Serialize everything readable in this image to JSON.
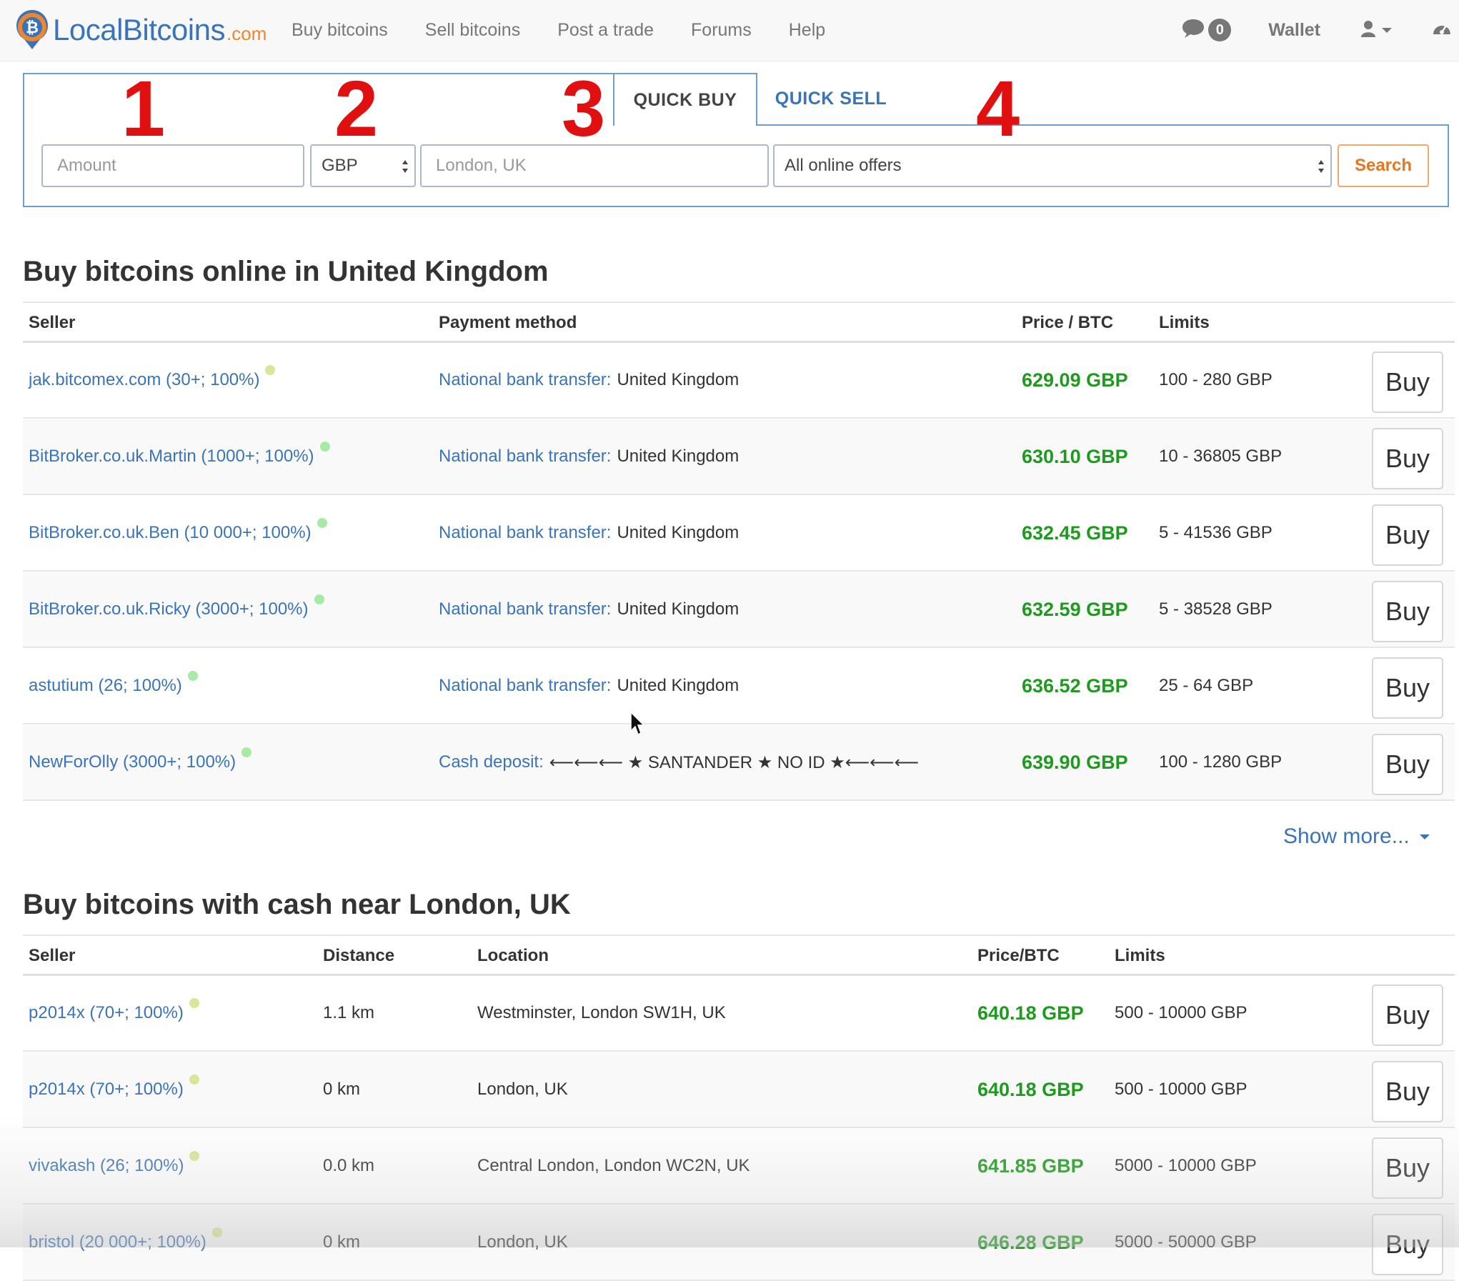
{
  "nav": {
    "logo_text": "LocalBitcoins",
    "logo_tld": ".com",
    "links": [
      "Buy bitcoins",
      "Sell bitcoins",
      "Post a trade",
      "Forums",
      "Help"
    ],
    "message_count": "0",
    "wallet": "Wallet"
  },
  "annotations": [
    "1",
    "2",
    "3",
    "4"
  ],
  "quick": {
    "tab_buy": "QUICK BUY",
    "tab_sell": "QUICK SELL",
    "amount_placeholder": "Amount",
    "currency": "GBP",
    "location_placeholder": "London, UK",
    "offer_type": "All online offers",
    "search_label": "Search"
  },
  "online": {
    "title": "Buy bitcoins online in United Kingdom",
    "headers": {
      "seller": "Seller",
      "payment": "Payment method",
      "price": "Price / BTC",
      "limits": "Limits"
    },
    "rows": [
      {
        "seller": "jak.bitcomex.com (30+; 100%)",
        "method": "National bank transfer:",
        "detail": "United Kingdom",
        "price": "629.09 GBP",
        "limits": "100 - 280 GBP",
        "buy": "Buy",
        "dot_color": "#d8e69a"
      },
      {
        "seller": "BitBroker.co.uk.Martin (1000+; 100%)",
        "method": "National bank transfer:",
        "detail": "United Kingdom",
        "price": "630.10 GBP",
        "limits": "10 - 36805 GBP",
        "buy": "Buy",
        "dot_color": "#a6eaa6"
      },
      {
        "seller": "BitBroker.co.uk.Ben (10 000+; 100%)",
        "method": "National bank transfer:",
        "detail": "United Kingdom",
        "price": "632.45 GBP",
        "limits": "5 - 41536 GBP",
        "buy": "Buy",
        "dot_color": "#a6eaa6"
      },
      {
        "seller": "BitBroker.co.uk.Ricky (3000+; 100%)",
        "method": "National bank transfer:",
        "detail": "United Kingdom",
        "price": "632.59 GBP",
        "limits": "5 - 38528 GBP",
        "buy": "Buy",
        "dot_color": "#a6eaa6"
      },
      {
        "seller": "astutium (26; 100%)",
        "method": "National bank transfer:",
        "detail": "United Kingdom",
        "price": "636.52 GBP",
        "limits": "25 - 64 GBP",
        "buy": "Buy",
        "dot_color": "#a6eaa6"
      },
      {
        "seller": "NewForOlly (3000+; 100%)",
        "method": "Cash deposit:",
        "detail": "⟵⟵⟵ ★ SANTANDER ★ NO ID ★⟵⟵⟵",
        "price": "639.90 GBP",
        "limits": "100 - 1280 GBP",
        "buy": "Buy",
        "dot_color": "#a6eaa6"
      }
    ],
    "show_more": "Show more..."
  },
  "cash": {
    "title": "Buy bitcoins with cash near London, UK",
    "headers": {
      "seller": "Seller",
      "distance": "Distance",
      "location": "Location",
      "price": "Price/BTC",
      "limits": "Limits"
    },
    "rows": [
      {
        "seller": "p2014x (70+; 100%)",
        "distance": "1.1 km",
        "location": "Westminster, London SW1H, UK",
        "price": "640.18 GBP",
        "limits": "500 - 10000 GBP",
        "buy": "Buy",
        "dot_color": "#d8e69a"
      },
      {
        "seller": "p2014x (70+; 100%)",
        "distance": "0 km",
        "location": "London, UK",
        "price": "640.18 GBP",
        "limits": "500 - 10000 GBP",
        "buy": "Buy",
        "dot_color": "#d8e69a"
      },
      {
        "seller": "vivakash (26; 100%)",
        "distance": "0.0 km",
        "location": "Central London, London WC2N, UK",
        "price": "641.85 GBP",
        "limits": "5000 - 10000 GBP",
        "buy": "Buy",
        "dot_color": "#d8e69a"
      },
      {
        "seller": "bristol (20 000+; 100%)",
        "distance": "0 km",
        "location": "London, UK",
        "price": "646.28 GBP",
        "limits": "5000 - 50000 GBP",
        "buy": "Buy",
        "dot_color": "#d8e69a"
      }
    ]
  },
  "colors": {
    "link": "#3a74b8",
    "price": "#1e9a1e",
    "accent": "#f0852d",
    "annotation": "#e01010",
    "panel_border": "#6c9fcd"
  },
  "icons": {
    "logo": "bitcoin-location-pin-icon",
    "chat": "chat-bubble-icon",
    "user": "user-icon",
    "dashboard": "gauge-icon"
  }
}
